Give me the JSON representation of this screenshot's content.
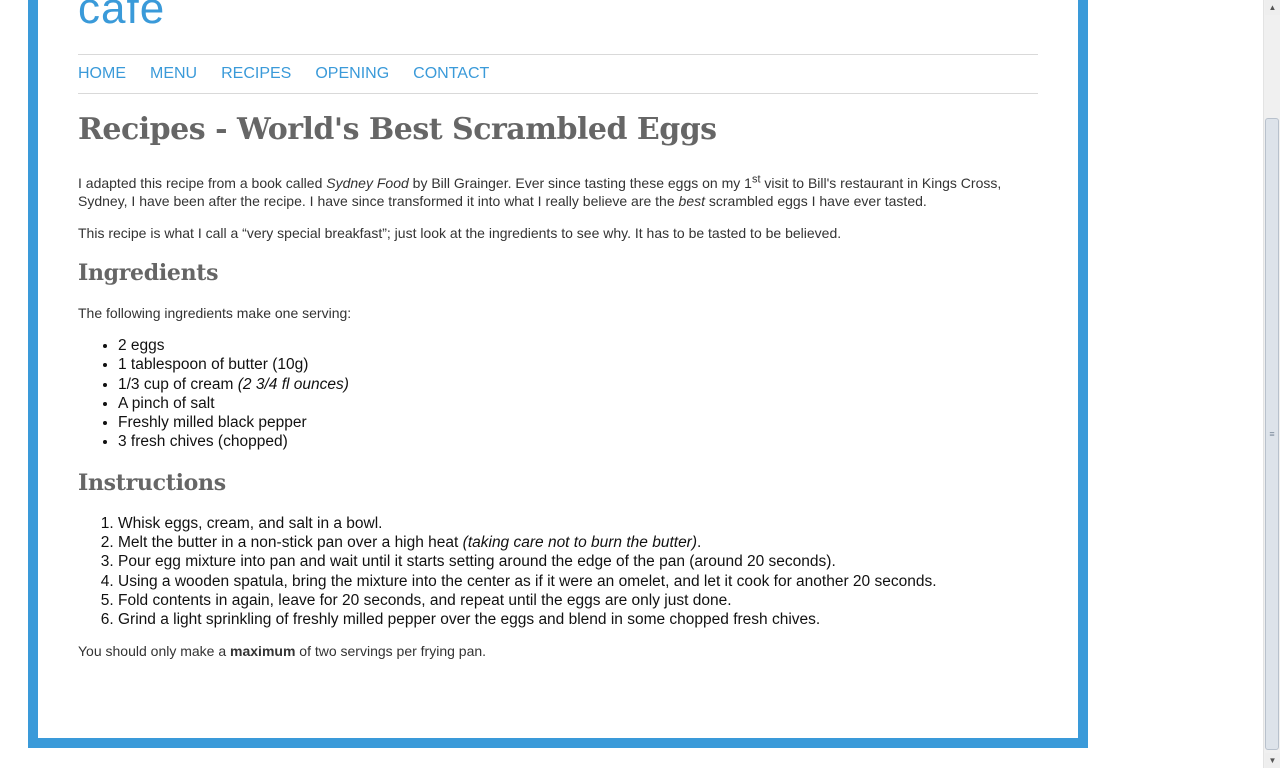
{
  "site": {
    "logo_text": "cafe",
    "brand_color": "#3a9ad9"
  },
  "nav": {
    "items": [
      {
        "label": "HOME"
      },
      {
        "label": "MENU"
      },
      {
        "label": "RECIPES"
      },
      {
        "label": "OPENING"
      },
      {
        "label": "CONTACT"
      }
    ]
  },
  "page": {
    "title": "Recipes - World's Best Scrambled Eggs",
    "intro1": {
      "a": "I adapted this recipe from a book called ",
      "book": "Sydney Food",
      "b": " by Bill Grainger. Ever since tasting these eggs on my 1",
      "sup": "st",
      "c": " visit to Bill's restaurant in Kings Cross, Sydney, I have been after the recipe. I have since transformed it into what I really believe are the ",
      "em": "best",
      "d": " scrambled eggs I have ever tasted."
    },
    "intro2": "This recipe is what I call a “very special breakfast”; just look at the ingredients to see why. It has to be tasted to be believed.",
    "ingredients": {
      "heading": "Ingredients",
      "lead": "The following ingredients make one serving:",
      "items": [
        {
          "text": "2 eggs",
          "note": ""
        },
        {
          "text": "1 tablespoon of butter (10g)",
          "note": ""
        },
        {
          "text": "1/3 cup of cream ",
          "note": "(2 3/4 fl ounces)"
        },
        {
          "text": "A pinch of salt",
          "note": ""
        },
        {
          "text": "Freshly milled black pepper",
          "note": ""
        },
        {
          "text": "3 fresh chives (chopped)",
          "note": ""
        }
      ]
    },
    "instructions": {
      "heading": "Instructions",
      "steps": [
        {
          "text": "Whisk eggs, cream, and salt in a bowl.",
          "note": "",
          "tail": ""
        },
        {
          "text": "Melt the butter in a non-stick pan over a high heat ",
          "note": "(taking care not to burn the butter)",
          "tail": "."
        },
        {
          "text": "Pour egg mixture into pan and wait until it starts setting around the edge of the pan (around 20 seconds).",
          "note": "",
          "tail": ""
        },
        {
          "text": "Using a wooden spatula, bring the mixture into the center as if it were an omelet, and let it cook for another 20 seconds.",
          "note": "",
          "tail": ""
        },
        {
          "text": "Fold contents in again, leave for 20 seconds, and repeat until the eggs are only just done.",
          "note": "",
          "tail": ""
        },
        {
          "text": "Grind a light sprinkling of freshly milled pepper over the eggs and blend in some chopped fresh chives.",
          "note": "",
          "tail": ""
        }
      ],
      "closing": {
        "a": "You should only make a ",
        "strong": "maximum",
        "b": " of two servings per frying pan."
      }
    }
  },
  "scrollbar": {
    "up_icon": "triangle-up",
    "down_icon": "triangle-down",
    "grip_icon": "grip-lines"
  }
}
